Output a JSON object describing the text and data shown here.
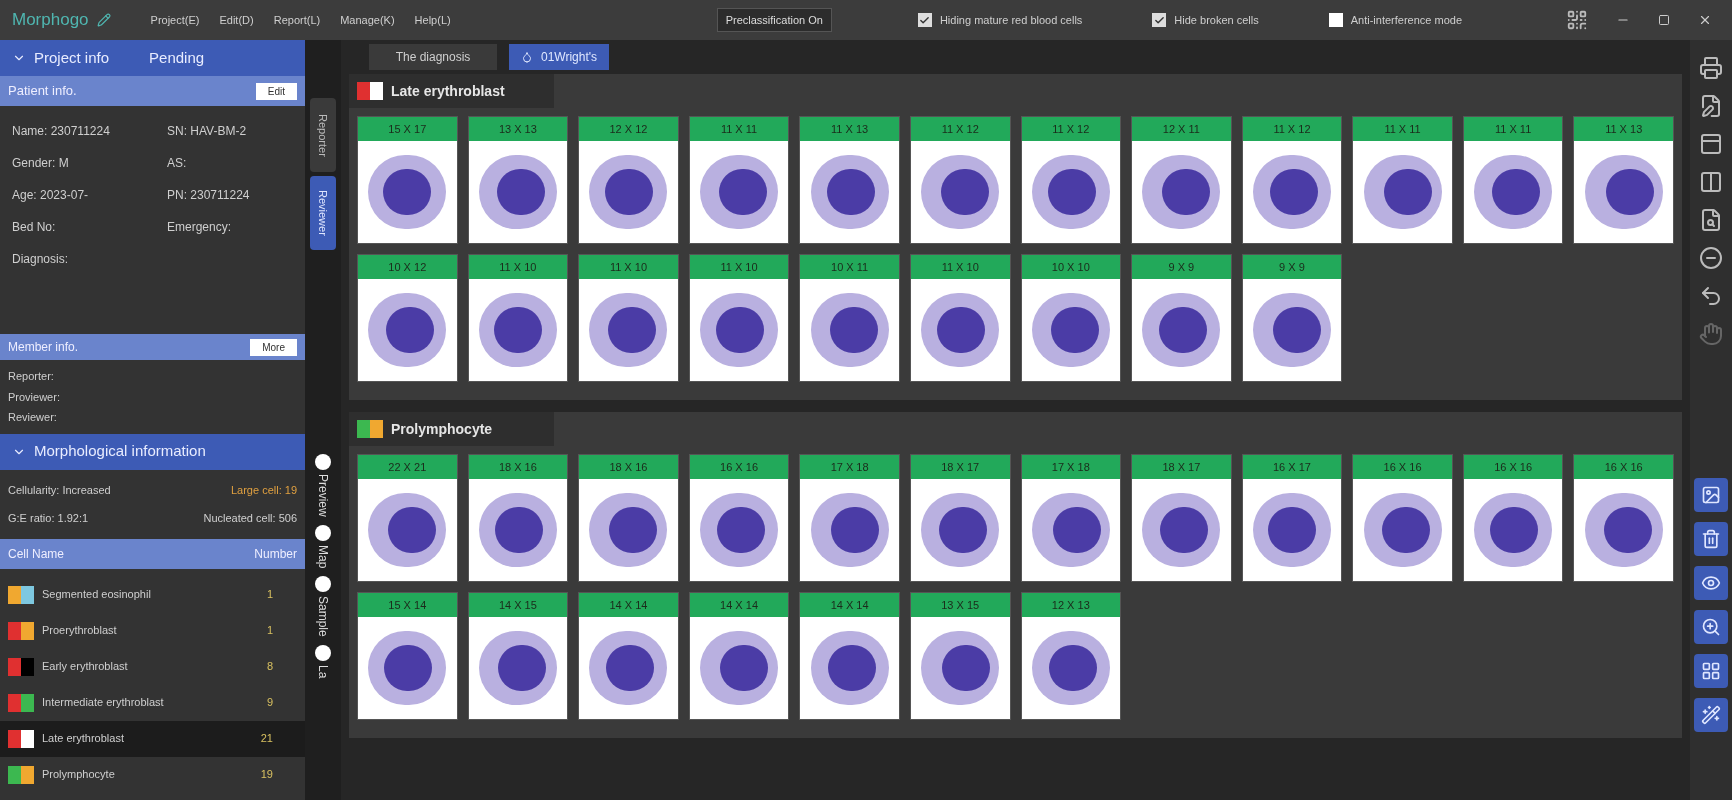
{
  "app": {
    "title": "Morphogo",
    "menu": [
      "Project(E)",
      "Edit(D)",
      "Report(L)",
      "Manage(K)",
      "Help(L)"
    ]
  },
  "toolbar": {
    "preclassification": "Preclassification On",
    "options": [
      {
        "label": "Hiding mature red blood cells",
        "checked": true
      },
      {
        "label": "Hide broken cells",
        "checked": true
      },
      {
        "label": "Anti-interference mode",
        "checked": false
      }
    ]
  },
  "sidebar": {
    "project": {
      "title": "Project info",
      "status": "Pending"
    },
    "patient": {
      "title": "Patient info.",
      "button": "Edit",
      "fields": [
        {
          "label": "Name:",
          "value": "230711224"
        },
        {
          "label": "SN:",
          "value": "HAV-BM-2"
        },
        {
          "label": "Gender:",
          "value": "M"
        },
        {
          "label": "AS:"
        },
        {
          "label": "Age:",
          "value": "2023-07-"
        },
        {
          "label": "PN:",
          "value": "230711224"
        },
        {
          "label": "Bed No:"
        },
        {
          "label": "Emergency:"
        },
        {
          "label": "Diagnosis:"
        }
      ]
    },
    "member": {
      "title": "Member info.",
      "button": "More",
      "lines": [
        "Reporter:",
        "Proviewer:",
        "Reviewer:"
      ]
    },
    "morphology": {
      "title": "Morphological information",
      "stats": [
        {
          "label": "Cellularity: Increased",
          "highlight": false
        },
        {
          "label": "Large cell: 19",
          "highlight": true
        },
        {
          "label": "G:E ratio: 1.92:1",
          "highlight": false
        },
        {
          "label": "Nucleated cell: 506",
          "highlight": false
        }
      ]
    },
    "cell_table": {
      "columns": [
        "Cell Name",
        "Number"
      ],
      "rows": [
        {
          "name": "Segmented eosinophil",
          "number": "1",
          "swatch": [
            {
              "color": "#f0a830"
            },
            {
              "color": "#7ec8e0"
            }
          ],
          "selected": false
        },
        {
          "name": "Proerythroblast",
          "number": "1",
          "swatch": [
            {
              "color": "#e03030"
            },
            {
              "color": "#f0a830"
            }
          ],
          "selected": false
        },
        {
          "name": "Early erythroblast",
          "number": "8",
          "swatch": [
            {
              "color": "#e03030"
            },
            {
              "color": "#000000"
            }
          ],
          "selected": false
        },
        {
          "name": "Intermediate erythroblast",
          "number": "9",
          "swatch": [
            {
              "color": "#e03030"
            },
            {
              "color": "#3cb850"
            }
          ],
          "selected": false
        },
        {
          "name": "Late erythroblast",
          "number": "21",
          "swatch": [
            {
              "color": "#e03030"
            },
            {
              "color": "#ffffff"
            }
          ],
          "selected": true
        },
        {
          "name": "Prolymphocyte",
          "number": "19",
          "swatch": [
            {
              "color": "#3cb850"
            },
            {
              "color": "#f0a830"
            }
          ],
          "selected": false
        }
      ]
    }
  },
  "side_tabs": [
    {
      "label": "Reporter",
      "selected": false
    },
    {
      "label": "Reviewer",
      "selected": true
    }
  ],
  "view_options": [
    "Preview",
    "Map",
    "Sample",
    "La"
  ],
  "tabs": [
    {
      "label": "The diagnosis",
      "selected": false
    },
    {
      "label": "01Wright's",
      "selected": true
    }
  ],
  "sections": [
    {
      "title": "Late erythroblast",
      "swatch": [
        {
          "color": "#e03030"
        },
        {
          "color": "#ffffff"
        }
      ],
      "cells": [
        "15 X 17",
        "13 X 13",
        "12 X 12",
        "11 X 11",
        "11 X 13",
        "11 X 12",
        "11 X 12",
        "12 X 11",
        "11 X 12",
        "11 X 11",
        "11 X 11",
        "11 X 13",
        "10 X 12",
        "11 X 10",
        "11 X 10",
        "11 X 10",
        "10 X 11",
        "11 X 10",
        "10 X 10",
        "9 X 9",
        "9 X 9"
      ]
    },
    {
      "title": "Prolymphocyte",
      "swatch": [
        {
          "color": "#3cb850"
        },
        {
          "color": "#f0a830"
        }
      ],
      "cells": [
        "22 X 21",
        "18 X 16",
        "18 X 16",
        "16 X 16",
        "17 X 18",
        "18 X 17",
        "17 X 18",
        "18 X 17",
        "16 X 17",
        "16 X 16",
        "16 X 16",
        "16 X 16",
        "15 X 14",
        "14 X 15",
        "14 X 14",
        "14 X 14",
        "14 X 14",
        "13 X 15",
        "12 X 13"
      ]
    }
  ]
}
